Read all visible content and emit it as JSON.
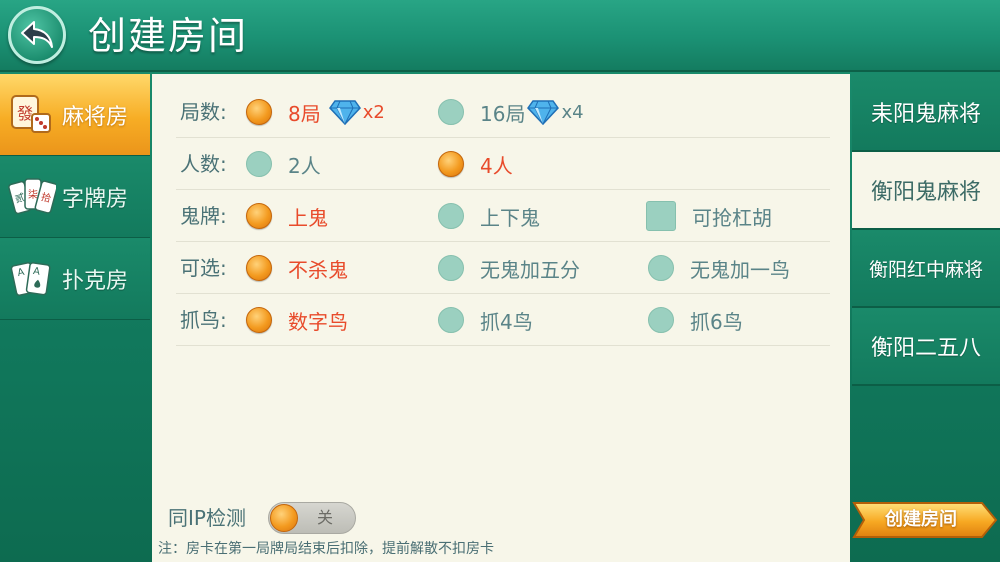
{
  "header": {
    "title": "创建房间"
  },
  "left_tabs": [
    {
      "label": "麻将房",
      "active": true,
      "icon": "mahjong-tile-dice-icon"
    },
    {
      "label": "字牌房",
      "active": false,
      "icon": "zipai-cards-icon"
    },
    {
      "label": "扑克房",
      "active": false,
      "icon": "poker-cards-icon"
    }
  ],
  "options": {
    "rounds": {
      "label": "局数:",
      "choices": [
        {
          "text": "8局",
          "selected": true,
          "icon": "diamond-icon",
          "multiplier": "x2"
        },
        {
          "text": "16局",
          "selected": false,
          "icon": "diamond-icon",
          "multiplier": "x4"
        }
      ]
    },
    "players": {
      "label": "人数:",
      "choices": [
        {
          "text": "2人",
          "selected": false
        },
        {
          "text": "4人",
          "selected": true
        }
      ]
    },
    "ghost": {
      "label": "鬼牌:",
      "choices": [
        {
          "text": "上鬼",
          "selected": true
        },
        {
          "text": "上下鬼",
          "selected": false
        },
        {
          "text": "可抢杠胡",
          "selected": false,
          "type": "checkbox"
        }
      ]
    },
    "optional": {
      "label": "可选:",
      "choices": [
        {
          "text": "不杀鬼",
          "selected": true
        },
        {
          "text": "无鬼加五分",
          "selected": false
        },
        {
          "text": "无鬼加一鸟",
          "selected": false
        }
      ]
    },
    "birds": {
      "label": "抓鸟:",
      "choices": [
        {
          "text": "数字鸟",
          "selected": true
        },
        {
          "text": "抓4鸟",
          "selected": false
        },
        {
          "text": "抓6鸟",
          "selected": false
        }
      ]
    }
  },
  "ip_check": {
    "label": "同IP检测",
    "toggle_text": "关",
    "on": false
  },
  "note": "注：房卡在第一局牌局结束后扣除，提前解散不扣房卡",
  "right_tabs": [
    {
      "label": "耒阳鬼麻将",
      "active": false
    },
    {
      "label": "衡阳鬼麻将",
      "active": true
    },
    {
      "label": "衡阳红中麻将",
      "active": false
    },
    {
      "label": "衡阳二五八",
      "active": false
    }
  ],
  "create_button": {
    "label": "创建房间"
  },
  "colors": {
    "header_green": "#1b9174",
    "panel_bg": "#f7f6e9",
    "selected_text": "#e84b2b",
    "radio_off": "#9bd0c0",
    "radio_on": "#f39a1f",
    "active_tab": "#f7ad25"
  }
}
